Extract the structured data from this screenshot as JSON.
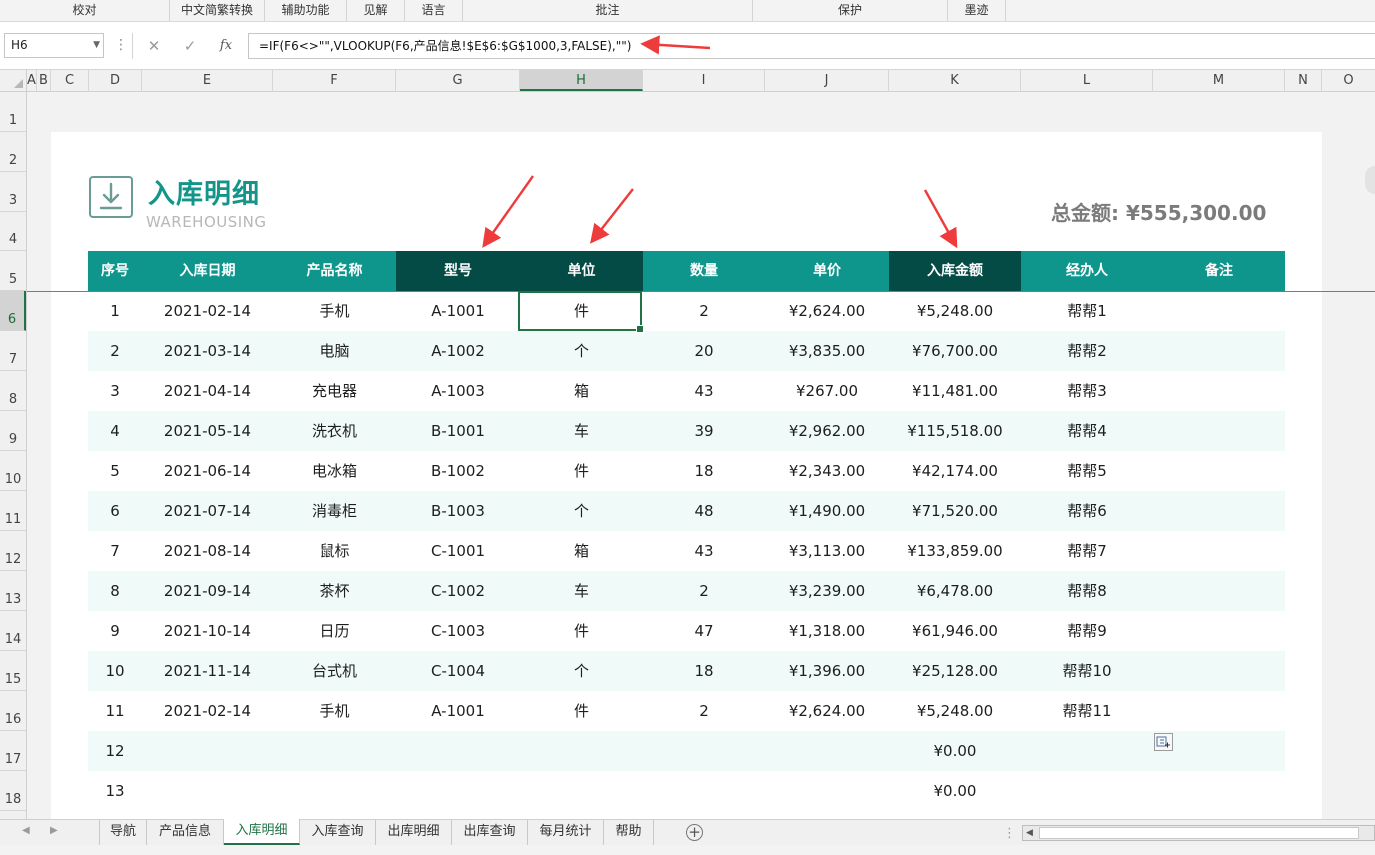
{
  "ribbon": {
    "groups": [
      "校对",
      "中文简繁转换",
      "辅助功能",
      "见解",
      "语言",
      "批注",
      "保护",
      "墨迹"
    ]
  },
  "formula_bar": {
    "name_box": "H6",
    "cancel_icon": "close-icon",
    "enter_icon": "check-icon",
    "function_label": "fx",
    "formula": "=IF(F6<>\"\",VLOOKUP(F6,产品信息!$E$6:$G$1000,3,FALSE),\"\")"
  },
  "columns": [
    "A",
    "B",
    "C",
    "D",
    "E",
    "F",
    "G",
    "H",
    "I",
    "J",
    "K",
    "L",
    "M",
    "N",
    "O"
  ],
  "selected_column": "H",
  "rows": [
    "1",
    "2",
    "3",
    "4",
    "5",
    "6",
    "7",
    "8",
    "9",
    "10",
    "11",
    "12",
    "13",
    "14",
    "15",
    "16",
    "17",
    "18"
  ],
  "selected_row": "6",
  "sheet": {
    "title": "入库明细",
    "subtitle": "WAREHOUSING",
    "total": "总金额: ¥555,300.00",
    "headers": [
      "序号",
      "入库日期",
      "产品名称",
      "型号",
      "单位",
      "数量",
      "单价",
      "入库金额",
      "经办人",
      "备注"
    ],
    "rows": [
      [
        "1",
        "2021-02-14",
        "手机",
        "A-1001",
        "件",
        "2",
        "¥2,624.00",
        "¥5,248.00",
        "帮帮1",
        ""
      ],
      [
        "2",
        "2021-03-14",
        "电脑",
        "A-1002",
        "个",
        "20",
        "¥3,835.00",
        "¥76,700.00",
        "帮帮2",
        ""
      ],
      [
        "3",
        "2021-04-14",
        "充电器",
        "A-1003",
        "箱",
        "43",
        "¥267.00",
        "¥11,481.00",
        "帮帮3",
        ""
      ],
      [
        "4",
        "2021-05-14",
        "洗衣机",
        "B-1001",
        "车",
        "39",
        "¥2,962.00",
        "¥115,518.00",
        "帮帮4",
        ""
      ],
      [
        "5",
        "2021-06-14",
        "电冰箱",
        "B-1002",
        "件",
        "18",
        "¥2,343.00",
        "¥42,174.00",
        "帮帮5",
        ""
      ],
      [
        "6",
        "2021-07-14",
        "消毒柜",
        "B-1003",
        "个",
        "48",
        "¥1,490.00",
        "¥71,520.00",
        "帮帮6",
        ""
      ],
      [
        "7",
        "2021-08-14",
        "鼠标",
        "C-1001",
        "箱",
        "43",
        "¥3,113.00",
        "¥133,859.00",
        "帮帮7",
        ""
      ],
      [
        "8",
        "2021-09-14",
        "茶杯",
        "C-1002",
        "车",
        "2",
        "¥3,239.00",
        "¥6,478.00",
        "帮帮8",
        ""
      ],
      [
        "9",
        "2021-10-14",
        "日历",
        "C-1003",
        "件",
        "47",
        "¥1,318.00",
        "¥61,946.00",
        "帮帮9",
        ""
      ],
      [
        "10",
        "2021-11-14",
        "台式机",
        "C-1004",
        "个",
        "18",
        "¥1,396.00",
        "¥25,128.00",
        "帮帮10",
        ""
      ],
      [
        "11",
        "2021-02-14",
        "手机",
        "A-1001",
        "件",
        "2",
        "¥2,624.00",
        "¥5,248.00",
        "帮帮11",
        ""
      ],
      [
        "12",
        "",
        "",
        "",
        "",
        "",
        "",
        "¥0.00",
        "",
        ""
      ],
      [
        "13",
        "",
        "",
        "",
        "",
        "",
        "",
        "¥0.00",
        "",
        ""
      ]
    ]
  },
  "tabs": [
    "导航",
    "产品信息",
    "入库明细",
    "入库查询",
    "出库明细",
    "出库查询",
    "每月统计",
    "帮助"
  ],
  "active_tab": "入库明细",
  "colors": {
    "accent": "#0f968c",
    "header_dark": "#044a45",
    "title": "#13958a",
    "annotation_arrow": "#ee3b3b",
    "excel_green": "#217346"
  }
}
